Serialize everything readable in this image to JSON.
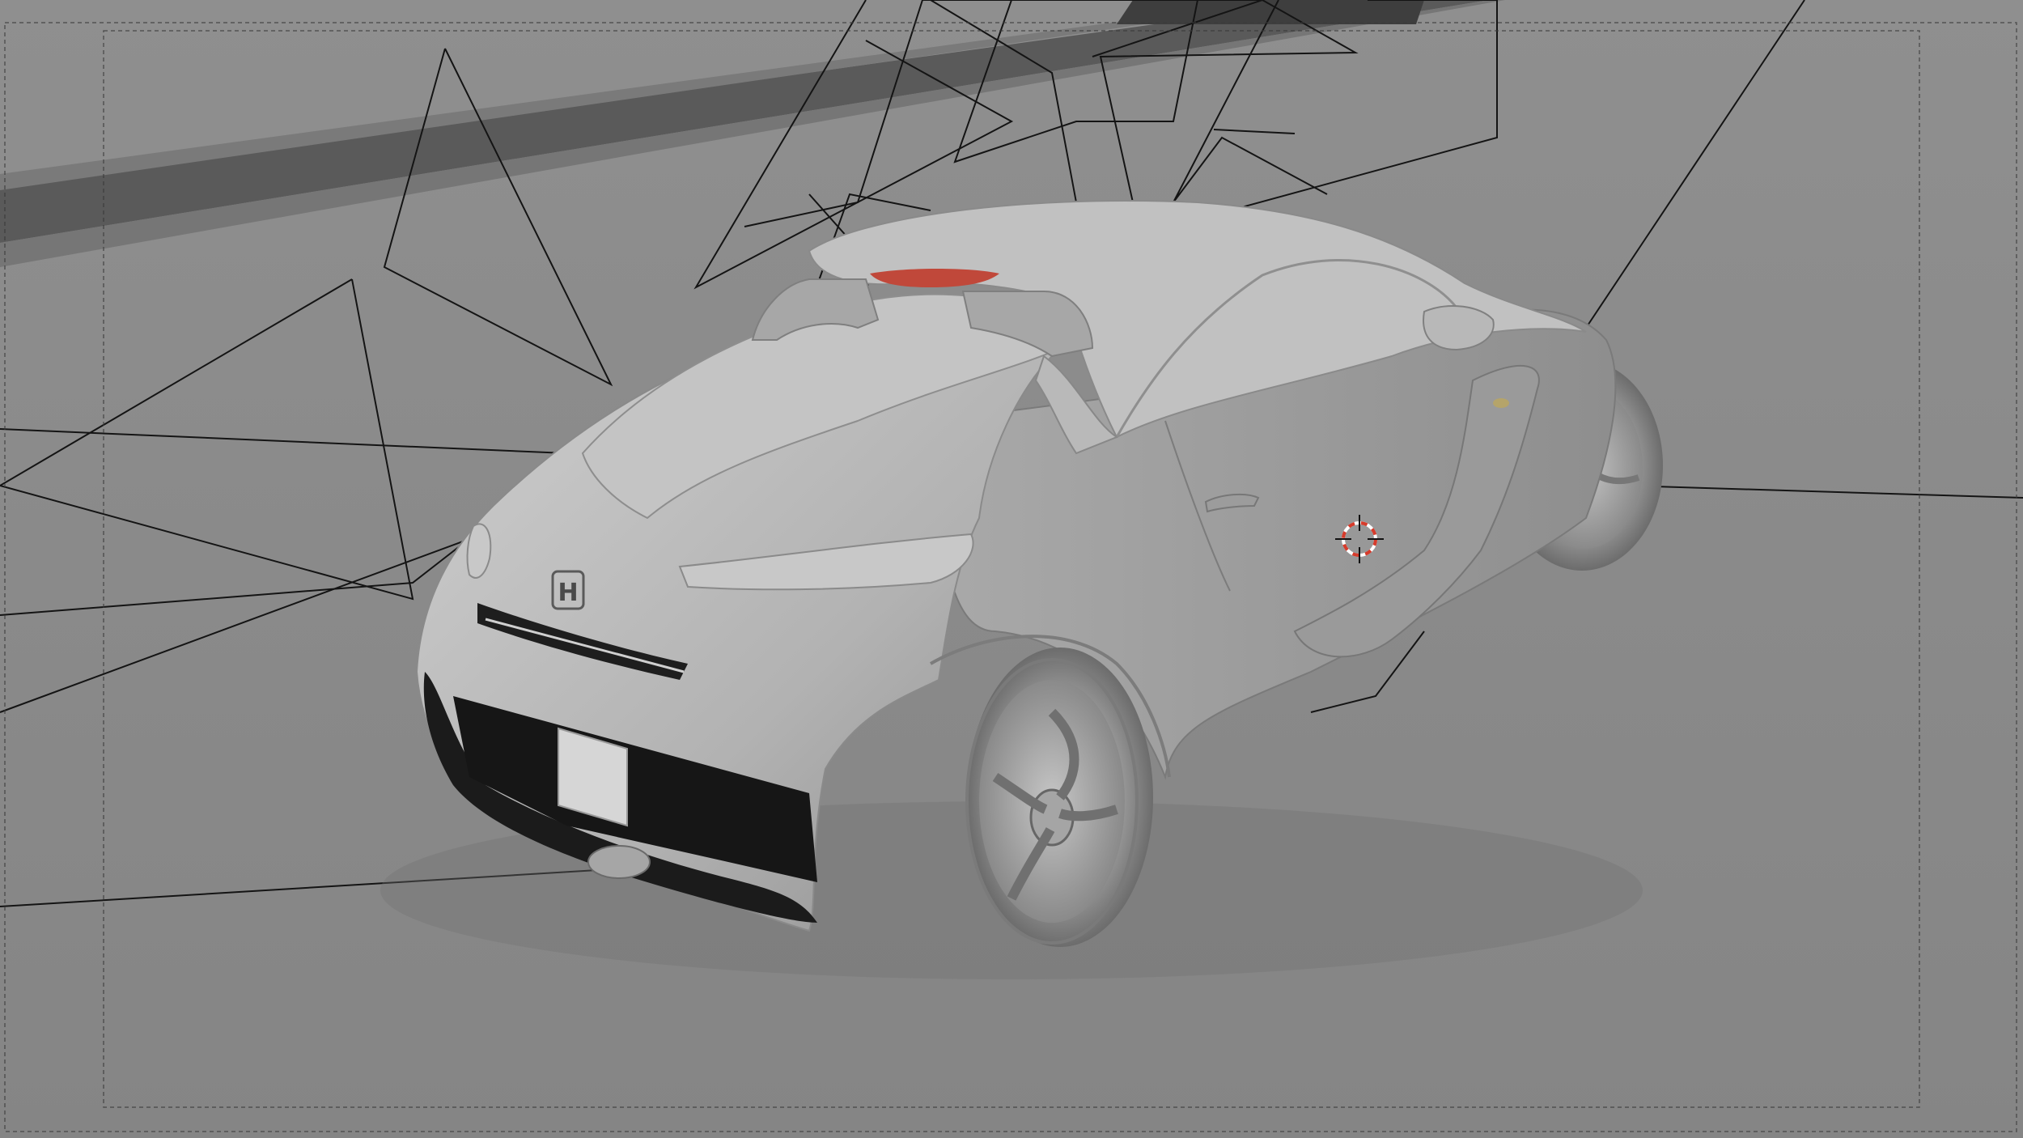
{
  "viewport": {
    "mode": "camera-view",
    "background_color": "#8a8a8a",
    "shading": "solid"
  },
  "scene": {
    "object": "sports-car-roadster",
    "badge": "H",
    "body_color": "#b9b9b9",
    "spoiler_light_color": "#c0483a",
    "grille_color": "#1a1a1a"
  },
  "overlays": {
    "light_rays": true,
    "camera_frame_guides": true,
    "3d_cursor": true,
    "cursor_colors": [
      "#d63b2b",
      "#ffffff"
    ]
  }
}
